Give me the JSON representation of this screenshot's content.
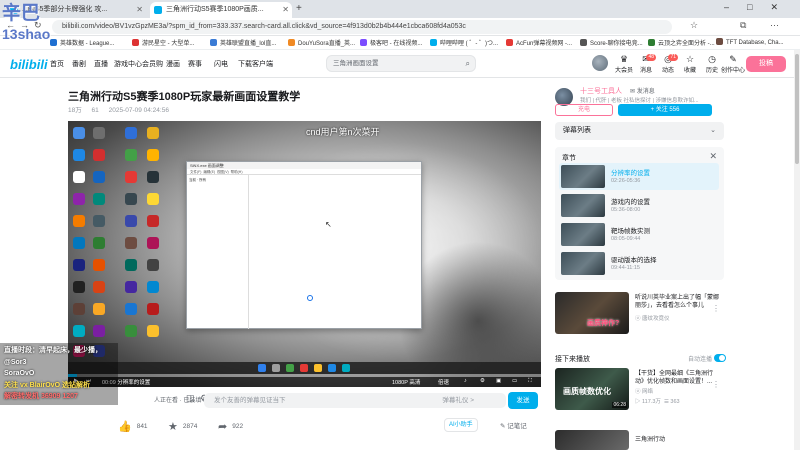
{
  "browser": {
    "tabs": [
      {
        "label": "...的S5季部分卡牌强化 攻..."
      },
      {
        "label": "三角洲行动S5赛季1080P画质..."
      }
    ],
    "url": "bilibili.com/video/BV1vzGpzME3a/?spm_id_from=333.337.search-card.all.click&vd_source=4f913d0b2b4b444e1cbca608fd4a053c",
    "bookmarks": [
      "英雄数据 - League...",
      "游民星空 - 大型单...",
      "英雄联盟直播_lol直...",
      "DouYuSora直播_英...",
      "极客吧 - 在线视频...",
      "哔哩哔哩 ( ゜- ゜)つ...",
      "AcFun弹幕视频网 -...",
      "Score-聊你接电竞...",
      "云顶之弈全面分析 -...",
      "TFT Database, Cha..."
    ]
  },
  "site": {
    "logo": "bilibili",
    "nav": [
      "首页",
      "番剧",
      "直播",
      "游戏中心",
      "会员购",
      "漫画",
      "赛事",
      "闪电",
      "下载客户端"
    ],
    "search_placeholder": "三角洲画面设置",
    "header_items": [
      {
        "icon": "member-icon",
        "label": "大会员"
      },
      {
        "icon": "message-icon",
        "label": "消息",
        "badge": "48"
      },
      {
        "icon": "dynamic-icon",
        "label": "动态",
        "badge": "71"
      },
      {
        "icon": "favorite-icon",
        "label": "收藏"
      },
      {
        "icon": "history-icon",
        "label": "历史"
      },
      {
        "icon": "creation-icon",
        "label": "创作中心"
      }
    ],
    "upload_label": "投稿",
    "accent": "#00aeec",
    "pink": "#fb7299"
  },
  "video": {
    "title": "三角洲行动S5赛季1080P玩家最新画面设置教学",
    "views": "18万",
    "danmaku_count": "61",
    "date": "2025-07-09 04:24:56",
    "danmaku_text": "cnd用户第n次菜开",
    "player_time": "00:09 分辨率的设置",
    "quality": "1080P 高清",
    "speed": "倍速",
    "watching": "人正在看 · 已装填 61 条弹幕",
    "dm_placeholder": "发个友善的弹幕见证当下",
    "dm_etiquette": "弹幕礼仪 >",
    "dm_send": "发送",
    "likes": "841",
    "coins": "2874",
    "shares": "922",
    "ai_label": "AI小助手",
    "notes_label": "记笔记",
    "desktop_window_title": "SiNX.exe 画面调整"
  },
  "overlay": {
    "watermark_top": "辛巴",
    "watermark_sub": "13shao",
    "stream_lines": [
      "直播时段：清早起床，最少播，",
      "@Sor3",
      "SoraOvO",
      "关注 vx BlairOvO 选钻解析",
      "解密转发机 36909 1207"
    ]
  },
  "up": {
    "name": "十三号工具人",
    "message": "发消息",
    "desc": "我们 | 代肝 | 老板 社私信探讨 | 涉嫌信息欺诈如...",
    "charge": "充电",
    "follow": "+ 关注 556"
  },
  "sidebar": {
    "danmaku_list": "弹幕列表",
    "chapters_title": "章节",
    "chapters": [
      {
        "name": "分辨率的设置",
        "time": "02:26-05:36"
      },
      {
        "name": "游戏内的设置",
        "time": "05:36-08:00"
      },
      {
        "name": "靶场帧数实测",
        "time": "08:05-09:44"
      },
      {
        "name": "驱动版本的选择",
        "time": "09:44-11:15"
      }
    ],
    "rec_top": {
      "title": "听说川英毕业案上出了幅「蒙娜丽莎」，去看看怎么个事儿",
      "up": "唐纹攻竟仪",
      "label": "画质神作?"
    },
    "next_up": "接下来播放",
    "autoplay": "自动连播",
    "rec_next": {
      "title": "【干货】全网最细《三角洲行动》优化帧数和画面设置！...",
      "up": "网络",
      "views": "117.3万",
      "comments": "363",
      "duration": "06:28",
      "thumb_text": "画质帧数优化"
    },
    "rec_third": {
      "title": "三角洲行动",
      "up": ""
    }
  }
}
